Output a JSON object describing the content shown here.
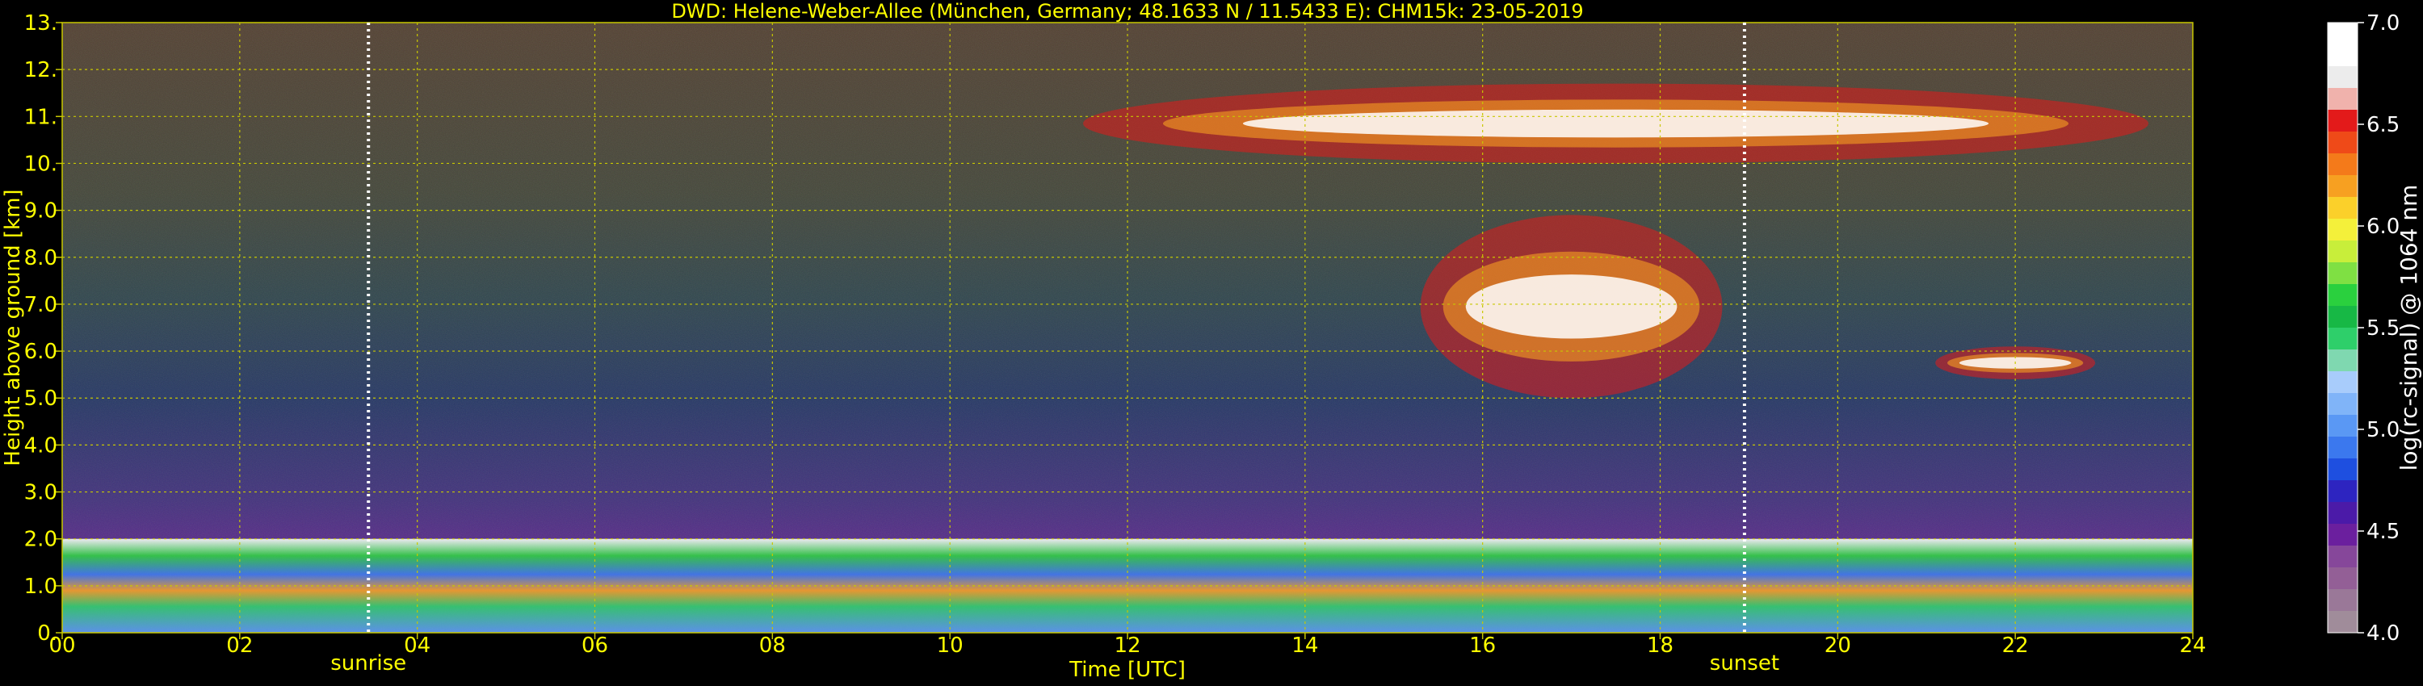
{
  "chart_data": {
    "type": "heatmap",
    "title": "DWD: Helene-Weber-Allee (München, Germany; 48.1633 N / 11.5433 E):    CHM15k: 23-05-2019",
    "xlabel": "Time [UTC]",
    "ylabel": "Height above ground [km]",
    "xlim": [
      0,
      24
    ],
    "ylim": [
      0,
      13
    ],
    "x_ticks": [
      {
        "value": 0,
        "label": "00"
      },
      {
        "value": 2,
        "label": "02"
      },
      {
        "value": 4,
        "label": "04"
      },
      {
        "value": 6,
        "label": "06"
      },
      {
        "value": 8,
        "label": "08"
      },
      {
        "value": 10,
        "label": "10"
      },
      {
        "value": 12,
        "label": "12"
      },
      {
        "value": 14,
        "label": "14"
      },
      {
        "value": 16,
        "label": "16"
      },
      {
        "value": 18,
        "label": "18"
      },
      {
        "value": 20,
        "label": "20"
      },
      {
        "value": 22,
        "label": "22"
      },
      {
        "value": 24,
        "label": "24"
      }
    ],
    "y_ticks": [
      {
        "value": 0,
        "label": "0."
      },
      {
        "value": 1,
        "label": "1.0"
      },
      {
        "value": 2,
        "label": "2.0"
      },
      {
        "value": 3,
        "label": "3.0"
      },
      {
        "value": 4,
        "label": "4.0"
      },
      {
        "value": 5,
        "label": "5.0"
      },
      {
        "value": 6,
        "label": "6.0"
      },
      {
        "value": 7,
        "label": "7.0"
      },
      {
        "value": 8,
        "label": "8.0"
      },
      {
        "value": 9,
        "label": "9.0"
      },
      {
        "value": 10,
        "label": "10."
      },
      {
        "value": 11,
        "label": "11."
      },
      {
        "value": 12,
        "label": "12."
      },
      {
        "value": 13,
        "label": "13."
      }
    ],
    "grid": true,
    "annotations": [
      {
        "label": "sunrise",
        "time": 3.45
      },
      {
        "label": "sunset",
        "time": 18.95
      }
    ],
    "colorbar": {
      "label": "log(rc-signal) @ 1064 nm",
      "range": [
        4.0,
        7.0
      ],
      "ticks": [
        {
          "value": 4.0,
          "label": "4.0"
        },
        {
          "value": 4.5,
          "label": "4.5"
        },
        {
          "value": 5.0,
          "label": "5.0"
        },
        {
          "value": 5.5,
          "label": "5.5"
        },
        {
          "value": 6.0,
          "label": "6.0"
        },
        {
          "value": 6.5,
          "label": "6.5"
        },
        {
          "value": 7.0,
          "label": "7.0"
        }
      ],
      "colors": [
        "#a08c9a",
        "#9a7898",
        "#935f96",
        "#86479a",
        "#6b1f9e",
        "#4b1aa8",
        "#2d24c0",
        "#1e4fe0",
        "#3b78ee",
        "#5a98f4",
        "#80b4f8",
        "#a8ccfb",
        "#7fd8b0",
        "#2ecf6a",
        "#17b845",
        "#2ad03e",
        "#7fe043",
        "#c8ee3a",
        "#f4f03a",
        "#fbd02a",
        "#f7a021",
        "#f47a1a",
        "#ef4a18",
        "#e31a1a",
        "#f0b2ac",
        "#ececec",
        "#ffffff",
        "#ffffff"
      ]
    },
    "layers": [
      {
        "name": "aerosol_boundary_layer",
        "time_range": [
          0,
          24
        ],
        "height_range": [
          0,
          2.0
        ]
      },
      {
        "name": "cirrus_cloud",
        "time_range": [
          11.5,
          23.5
        ],
        "height_range": [
          10.0,
          11.7
        ]
      },
      {
        "name": "mid_level_cloud",
        "time_range": [
          15.3,
          18.7
        ],
        "height_range": [
          5.0,
          8.9
        ]
      },
      {
        "name": "mid_level_cloud",
        "time_range": [
          21.1,
          22.9
        ],
        "height_range": [
          5.4,
          6.1
        ]
      }
    ]
  },
  "colors": {
    "axis_text": "#ffff00",
    "grid": "#c8c800",
    "colorbar_text": "#ffffff",
    "annotation_line": "#ffffff"
  }
}
